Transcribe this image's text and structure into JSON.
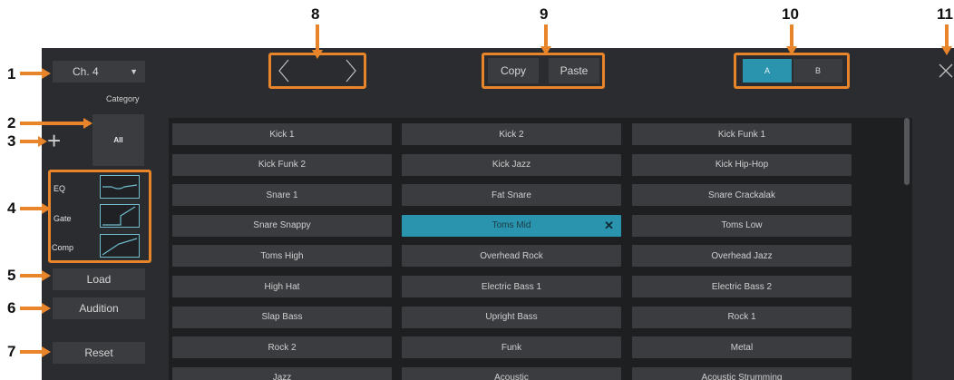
{
  "callouts": [
    "1",
    "2",
    "3",
    "4",
    "5",
    "6",
    "7",
    "8",
    "9",
    "10",
    "11"
  ],
  "channel_select": {
    "value": "Ch. 4",
    "caret": "▼"
  },
  "category": {
    "label": "Category",
    "selected": "All",
    "add_symbol": "+"
  },
  "processors": [
    {
      "label": "EQ",
      "icon": "eq-curve-icon"
    },
    {
      "label": "Gate",
      "icon": "gate-curve-icon"
    },
    {
      "label": "Comp",
      "icon": "comp-curve-icon"
    }
  ],
  "actions": {
    "load": "Load",
    "audition": "Audition",
    "reset": "Reset"
  },
  "nav": {
    "prev_icon": "chevron-left-icon",
    "next_icon": "chevron-right-icon"
  },
  "clipboard": {
    "copy": "Copy",
    "paste": "Paste"
  },
  "ab": {
    "a": "A",
    "b": "B",
    "active": "A"
  },
  "close_icon": "close-icon",
  "presets": [
    [
      "Kick 1",
      "Kick 2",
      "Kick Funk 1"
    ],
    [
      "Kick Funk 2",
      "Kick Jazz",
      "Kick Hip-Hop"
    ],
    [
      "Snare 1",
      "Fat Snare",
      "Snare Crackalak"
    ],
    [
      "Snare Snappy",
      "Toms Mid",
      "Toms Low"
    ],
    [
      "Toms High",
      "Overhead Rock",
      "Overhead Jazz"
    ],
    [
      "High Hat",
      "Electric Bass 1",
      "Electric Bass 2"
    ],
    [
      "Slap Bass",
      "Upright Bass",
      "Rock 1"
    ],
    [
      "Rock 2",
      "Funk",
      "Metal"
    ],
    [
      "Jazz",
      "Acoustic",
      "Acoustic Strumming"
    ]
  ],
  "selected_preset": "Toms Mid",
  "selected_clear_symbol": "✕",
  "colors": {
    "accent": "#2a93ad",
    "callout": "#e8842a",
    "panel": "#2a2c2f"
  }
}
